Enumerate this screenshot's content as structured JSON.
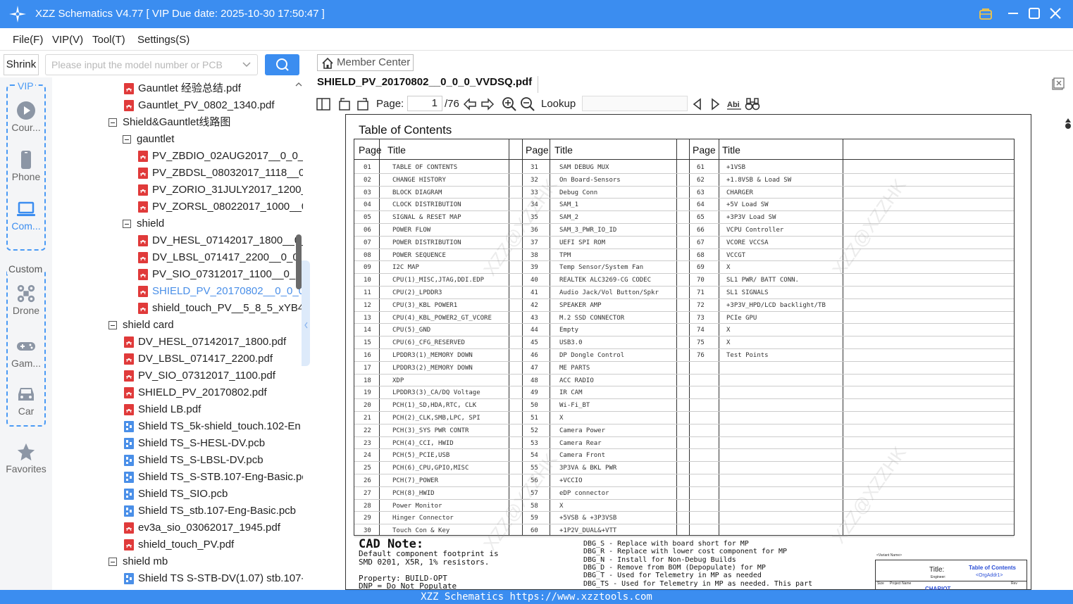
{
  "window": {
    "title": "XZZ Schematics V4.77 [ VIP Due date: 2025-10-30 17:50:47 ]"
  },
  "menu": [
    "File(F)",
    "VIP(V)",
    "Tool(T)",
    "Settings(S)"
  ],
  "search": {
    "shrink_label": "Shrink",
    "placeholder": "Please input the model number or PCB"
  },
  "leftnav": {
    "vip_label": "VIP",
    "custom_label": "Custom",
    "items": [
      "Cour...",
      "Phone",
      "Com...",
      "Drone",
      "Gam...",
      "Car",
      "Favorites"
    ]
  },
  "tree": [
    {
      "type": "pdf",
      "label": "Gauntlet 经验总结.pdf"
    },
    {
      "type": "pdf",
      "label": "Gauntlet_PV_0802_1340.pdf"
    },
    {
      "type": "folder",
      "label": "Shield&Gauntlet线路图"
    },
    {
      "type": "folder",
      "label": "gauntlet"
    },
    {
      "type": "pdf",
      "label": "PV_ZBDIO_02AUG2017__0_0_("
    },
    {
      "type": "pdf",
      "label": "PV_ZBDSL_08032017_1118__0"
    },
    {
      "type": "pdf",
      "label": "PV_ZORIO_31JULY2017_1200_"
    },
    {
      "type": "pdf",
      "label": "PV_ZORSL_08022017_1000__0"
    },
    {
      "type": "folder",
      "label": "shield"
    },
    {
      "type": "pdf",
      "label": "DV_HESL_07142017_1800__0_("
    },
    {
      "type": "pdf",
      "label": "DV_LBSL_071417_2200__0_0_0"
    },
    {
      "type": "pdf",
      "label": "PV_SIO_07312017_1100__0_1_("
    },
    {
      "type": "pdf",
      "label": "SHIELD_PV_20170802__0_0_0_"
    },
    {
      "type": "pdf",
      "label": "shield_touch_PV__5_8_5_xYB4l"
    },
    {
      "type": "folder",
      "label": "shield card"
    },
    {
      "type": "pdf",
      "label": "DV_HESL_07142017_1800.pdf"
    },
    {
      "type": "pdf",
      "label": "DV_LBSL_071417_2200.pdf"
    },
    {
      "type": "pdf",
      "label": "PV_SIO_07312017_1100.pdf"
    },
    {
      "type": "pdf",
      "label": "SHIELD_PV_20170802.pdf"
    },
    {
      "type": "pdf",
      "label": "Shield LB.pdf"
    },
    {
      "type": "pcb",
      "label": "Shield TS_5k-shield_touch.102-En"
    },
    {
      "type": "pcb",
      "label": "Shield TS_S-HESL-DV.pcb"
    },
    {
      "type": "pcb",
      "label": "Shield TS_S-LBSL-DV.pcb"
    },
    {
      "type": "pcb",
      "label": "Shield TS_S-STB.107-Eng-Basic.pc"
    },
    {
      "type": "pcb",
      "label": "Shield TS_SIO.pcb"
    },
    {
      "type": "pcb",
      "label": "Shield TS_stb.107-Eng-Basic.pcb"
    },
    {
      "type": "pdf",
      "label": "ev3a_sio_03062017_1945.pdf"
    },
    {
      "type": "pdf",
      "label": "shield_touch_PV.pdf"
    },
    {
      "type": "folder",
      "label": "shield mb"
    },
    {
      "type": "pcb",
      "label": "Shield TS S-STB-DV(1.07) stb.107-"
    }
  ],
  "selected_tree_index": 12,
  "viewer": {
    "member_center": "Member Center",
    "doc_tab": "SHIELD_PV_20170802__0_0_0_VVDSQ.pdf",
    "page_label": "Page:",
    "page_current": "1",
    "page_total": "/76",
    "lookup_label": "Lookup"
  },
  "toc": {
    "title": "Table of Contents",
    "col_page": "Page",
    "col_title": "Title",
    "col1": [
      [
        "01",
        "TABLE OF CONTENTS"
      ],
      [
        "02",
        "CHANGE HISTORY"
      ],
      [
        "03",
        "BLOCK DIAGRAM"
      ],
      [
        "04",
        "CLOCK DISTRIBUTION"
      ],
      [
        "05",
        "SIGNAL & RESET MAP"
      ],
      [
        "06",
        "POWER FLOW"
      ],
      [
        "07",
        "POWER DISTRIBUTION"
      ],
      [
        "08",
        "POWER SEQUENCE"
      ],
      [
        "09",
        "I2C MAP"
      ],
      [
        "10",
        "CPU(1)_MISC,JTAG,DDI.EDP"
      ],
      [
        "11",
        "CPU(2)_LPDDR3"
      ],
      [
        "12",
        "CPU(3)_KBL POWER1"
      ],
      [
        "13",
        "CPU(4)_KBL_POWER2_GT_VCORE"
      ],
      [
        "14",
        "CPU(5)_GND"
      ],
      [
        "15",
        "CPU(6)_CFG_RESERVED"
      ],
      [
        "16",
        "LPDDR3(1)_MEMORY DOWN"
      ],
      [
        "17",
        "LPDDR3(2)_MEMORY DOWN"
      ],
      [
        "18",
        "XDP"
      ],
      [
        "19",
        "LPDDR3(3)_CA/DQ Voltage"
      ],
      [
        "20",
        "PCH(1)_SD,HDA,RTC, CLK"
      ],
      [
        "21",
        "PCH(2)_CLK,SMB,LPC, SPI"
      ],
      [
        "22",
        "PCH(3)_SYS PWR CONTR"
      ],
      [
        "23",
        "PCH(4)_CCI, HWID"
      ],
      [
        "24",
        "PCH(5)_PCIE,USB"
      ],
      [
        "25",
        "PCH(6)_CPU,GPIO,MISC"
      ],
      [
        "26",
        "PCH(7)_POWER"
      ],
      [
        "27",
        "PCH(8)_HWID"
      ],
      [
        "28",
        "Power Monitor"
      ],
      [
        "29",
        "Hinger Connector"
      ],
      [
        "30",
        "Touch Con & Key"
      ]
    ],
    "col2": [
      [
        "31",
        "SAM DEBUG MUX"
      ],
      [
        "32",
        "On Board-Sensors"
      ],
      [
        "33",
        "Debug Conn"
      ],
      [
        "34",
        "SAM_1"
      ],
      [
        "35",
        "SAM_2"
      ],
      [
        "36",
        "SAM_3_PWR_IO_ID"
      ],
      [
        "37",
        "UEFI SPI ROM"
      ],
      [
        "38",
        "TPM"
      ],
      [
        "39",
        "Temp Sensor/System Fan"
      ],
      [
        "40",
        "REALTEK ALC3269-CG CODEC"
      ],
      [
        "41",
        "Audio Jack/Vol Button/Spkr"
      ],
      [
        "42",
        "SPEAKER AMP"
      ],
      [
        "43",
        "M.2 SSD CONNECTOR"
      ],
      [
        "44",
        "Empty"
      ],
      [
        "45",
        "USB3.0"
      ],
      [
        "46",
        "DP Dongle Control"
      ],
      [
        "47",
        "ME PARTS"
      ],
      [
        "48",
        "ACC RADIO"
      ],
      [
        "49",
        "IR CAM"
      ],
      [
        "50",
        "Wi-Fi_BT"
      ],
      [
        "51",
        "X"
      ],
      [
        "52",
        "Camera Power"
      ],
      [
        "53",
        "Camera Rear"
      ],
      [
        "54",
        "Camera Front"
      ],
      [
        "55",
        "3P3VA & BKL PWR"
      ],
      [
        "56",
        "+VCCIO"
      ],
      [
        "57",
        "eDP connector"
      ],
      [
        "58",
        "X"
      ],
      [
        "59",
        "+5VSB & +3P3VSB"
      ],
      [
        "60",
        "+1P2V_DUAL&+VTT"
      ]
    ],
    "col3": [
      [
        "61",
        "+1VSB"
      ],
      [
        "62",
        "+1.8VSB & Load SW"
      ],
      [
        "63",
        "CHARGER"
      ],
      [
        "64",
        "+5V Load SW"
      ],
      [
        "65",
        "+3P3V Load SW"
      ],
      [
        "66",
        "VCPU Controller"
      ],
      [
        "67",
        "VCORE VCCSA"
      ],
      [
        "68",
        "VCCGT"
      ],
      [
        "69",
        "X"
      ],
      [
        "70",
        "SL1 PWR/ BATT CONN."
      ],
      [
        "71",
        "SL1 SIGNALS"
      ],
      [
        "72",
        "+3P3V_HPD/LCD backlight/TB"
      ],
      [
        "73",
        "PCIe GPU"
      ],
      [
        "74",
        "X"
      ],
      [
        "75",
        "X"
      ],
      [
        "76",
        "Test Points"
      ]
    ],
    "watermark": "XZZ@XZZHK",
    "cad_heading": "CAD Note:",
    "cad_lines": [
      "Default component footprint is",
      "SMD 0201, X5R, 1% resistors.",
      "",
      "Property: BUILD-OPT",
      "DNP = Do Not Populate"
    ],
    "dbg_lines": [
      "DBG_S - Replace with board short for MP",
      "DBG_R - Replace with lower cost component for MP",
      "DBG_N - Install for Non-Debug Builds",
      "DBG_D - Remove from BOM (Depopulate) for MP",
      "DBG_T - Used for Telemetry in MP as needed",
      "DBG_TS - Used for Telemetry in MP as needed. This part"
    ],
    "titleblock": {
      "variant": "<Variant Name>",
      "title_label": "Title:",
      "title_value": "Table of Contents",
      "engineer_label": "Engineer:",
      "engineer_value": "<OrgAddr1>",
      "size_label": "Size",
      "project_label": "Project Name",
      "project_value": "CHARIOT",
      "rev_label": "Rev"
    }
  },
  "statusbar": "XZZ Schematics https://www.xzztools.com",
  "colors": {
    "accent": "#3b8df0",
    "pdf": "#e03a3a",
    "pcb": "#4a8fe8",
    "selected": "#4a8fe8"
  }
}
